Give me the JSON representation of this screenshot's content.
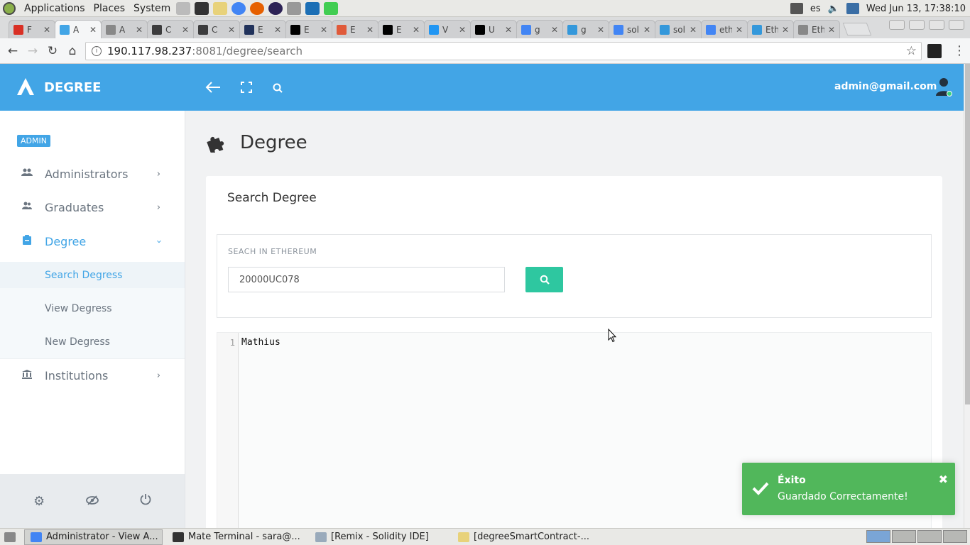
{
  "os": {
    "menu": [
      "Applications",
      "Places",
      "System"
    ],
    "keyboard_layout": "es",
    "clock": "Wed Jun 13, 17:38:10"
  },
  "browser": {
    "tabs": [
      {
        "title": "F",
        "favicon": "gmail-icon",
        "color": "#d93025"
      },
      {
        "title": "A",
        "favicon": "degree-app-icon",
        "color": "#42a5e6",
        "active": true
      },
      {
        "title": "A",
        "favicon": "document-icon",
        "color": "#888888"
      },
      {
        "title": "C",
        "favicon": "ethereum-icon",
        "color": "#3c3c3d"
      },
      {
        "title": "C",
        "favicon": "ethereum-icon",
        "color": "#3c3c3d"
      },
      {
        "title": "E",
        "favicon": "etherscan-icon",
        "color": "#21325b"
      },
      {
        "title": "E",
        "favicon": "medium-icon",
        "color": "#000000"
      },
      {
        "title": "E",
        "favicon": "remix-icon",
        "color": "#e05a3a"
      },
      {
        "title": "E",
        "favicon": "medium-icon",
        "color": "#000000"
      },
      {
        "title": "V",
        "favicon": "web-icon",
        "color": "#2196f3"
      },
      {
        "title": "U",
        "favicon": "black-square-icon",
        "color": "#000000"
      },
      {
        "title": "g",
        "favicon": "google-icon",
        "color": "#4285f4"
      },
      {
        "title": "g",
        "favicon": "eth-stack-icon",
        "color": "#3498db"
      },
      {
        "title": "solid",
        "favicon": "google-icon",
        "color": "#4285f4"
      },
      {
        "title": "solid",
        "favicon": "eth-stack-icon",
        "color": "#3498db"
      },
      {
        "title": "ethe",
        "favicon": "google-icon",
        "color": "#4285f4"
      },
      {
        "title": "Ethe",
        "favicon": "eth-stack-icon",
        "color": "#3498db"
      },
      {
        "title": "Ethe",
        "favicon": "document-icon",
        "color": "#888888"
      }
    ],
    "url_host": "190.117.98.237",
    "url_path": ":8081/degree/search"
  },
  "app": {
    "brand": "DEGREE",
    "user_email": "admin@gmail.com",
    "role_badge": "ADMIN",
    "nav": [
      {
        "label": "Administrators",
        "icon": "users-icon"
      },
      {
        "label": "Graduates",
        "icon": "graduates-icon"
      },
      {
        "label": "Degree",
        "icon": "clipboard-icon",
        "active": true
      },
      {
        "label": "Institutions",
        "icon": "institution-icon"
      }
    ],
    "submenu": [
      {
        "label": "Search Degress",
        "active": true
      },
      {
        "label": "View Degress"
      },
      {
        "label": "New Degress"
      }
    ],
    "page_title": "Degree",
    "card_title": "Search Degree",
    "search_label": "SEACH IN ETHEREUM",
    "search_value": "20000UC078",
    "editor_line_number": "1",
    "editor_content": "Mathius"
  },
  "toast": {
    "title": "Éxito",
    "message": "Guardado Correctamente!",
    "color": "#51b75b"
  },
  "taskbar": [
    {
      "label": "Administrator - View A...",
      "icon": "chrome-icon",
      "active": true
    },
    {
      "label": "Mate Terminal - sara@...",
      "icon": "terminal-icon"
    },
    {
      "label": "[Remix - Solidity IDE]",
      "icon": "window-icon"
    },
    {
      "label": "[degreeSmartContract-...",
      "icon": "text-editor-icon"
    }
  ],
  "colors": {
    "header": "#42a5e6",
    "search_button": "#2ec7a0",
    "accent": "#42a5e6"
  }
}
